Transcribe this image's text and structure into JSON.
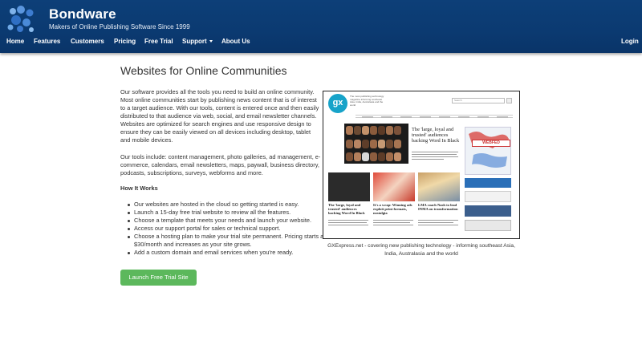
{
  "brand": {
    "name": "Bondware",
    "tagline": "Makers of Online Publishing Software Since 1999"
  },
  "nav": {
    "items": [
      "Home",
      "Features",
      "Customers",
      "Pricing",
      "Free Trial",
      "Support",
      "About Us"
    ],
    "login": "Login"
  },
  "main": {
    "title": "Websites for Online Communities",
    "paragraph1": "Our software provides all the tools you need to build an online community. Most online communities start by publishing news content that is of interest to a target audience.  With our tools, content is entered once and then easily distributed to that audience via web, social, and email newsletter channels. Websites are optimized for search engines and use responsive design to ensure they can be easily viewed on all devices including desktop, tablet and mobile devices.",
    "paragraph2": "Our tools include: content management, photo galleries, ad management, e-commerce, calendars, email newsletters, maps, paywall, business directory, podcasts, subscriptions, surveys, webforms and more.",
    "how_title": "How It Works",
    "steps": [
      "Our websites are hosted in the cloud so getting started is easy.",
      "Launch a 15-day free trial website to review all the features.",
      "Choose a template that meets your needs and launch your website.",
      "Access our support portal for sales or technical support.",
      "Choose a hosting plan to make your trial site permanent.  Pricing starts at $30/month and increases as your site grows.",
      "Add a custom domain and email services when you're ready."
    ],
    "cta": "Launch Free Trial Site"
  },
  "showcase": {
    "caption": "GXExpress.net - covering new publishing technology - informing southeast Asia, India, Australasia and the world",
    "logo_text": "gx",
    "site_tagline": "The most publishing technology magazine informing southeast Asia, India, Australasia and the world",
    "search_placeholder": "Search",
    "headline_main": "The 'large, loyal and trusted' audiences backing Word In Black",
    "headline_1": "The 'large, loyal and trusted' audiences backing Word In Black",
    "headline_2": "It's a wrap: Winning ads exploit print formats, nostalgia",
    "headline_3": "LMA coach Nash to lead INMA on transformation",
    "banner_text": "WEBFED"
  },
  "colors": {
    "header_bg": "#0b3a71",
    "cta_bg": "#5cb85c",
    "gx_blue": "#17a3c9"
  }
}
